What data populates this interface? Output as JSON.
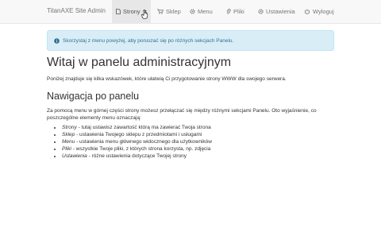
{
  "navbar": {
    "brand": "TitanAXE Site Admin",
    "items": [
      {
        "label": "Strony",
        "icon": "document-icon",
        "active": true
      },
      {
        "label": "Sklep",
        "icon": "cart-icon"
      },
      {
        "label": "Menu",
        "icon": "gear-icon"
      },
      {
        "label": "Pliki",
        "icon": "paperclip-icon"
      },
      {
        "label": "Ustawienia",
        "icon": "settings-icon"
      },
      {
        "label": "Wyloguj",
        "icon": "logout-icon"
      }
    ]
  },
  "alert": {
    "icon": "info-icon",
    "text": "Skorzystaj z menu powyżej, aby poruszać się po różnych sekcjach Panelu."
  },
  "main": {
    "title": "Witaj w panelu administracyjnym",
    "intro": "Poniżej znajduje się kilka wskazówek, które ułatwią Ci przygotowanie strony WWW dla swojego serwera.",
    "nav_heading": "Nawigacja po panelu",
    "nav_paragraph": "Za pomocą menu w górnej części strony możesz przełączać się między różnymi sekcjami Panelu. Oto wyjaśnienie, co poszczególne elementy menu oznaczają:",
    "items": [
      {
        "term": "Strony",
        "desc": " - tutaj ustawisz zawartość którą ma zawierać Twoja strona"
      },
      {
        "term": "Sklep",
        "desc": " - ustawienia Twojego sklepu z przedmiotami i usługami"
      },
      {
        "term": "Menu",
        "desc": " - ustawienia menu głównego widocznego dla użytkowników"
      },
      {
        "term": "Pliki",
        "desc": " - wszystkie Twoje pliki, z których strona korzysta, np. zdjęcia"
      },
      {
        "term": "Ustawienia",
        "desc": " - różne ustawienia dotyczące Twojej strony"
      }
    ]
  },
  "colors": {
    "navbar_bg": "#f8f8f8",
    "alert_bg": "#d9edf7",
    "alert_text": "#31708f"
  }
}
